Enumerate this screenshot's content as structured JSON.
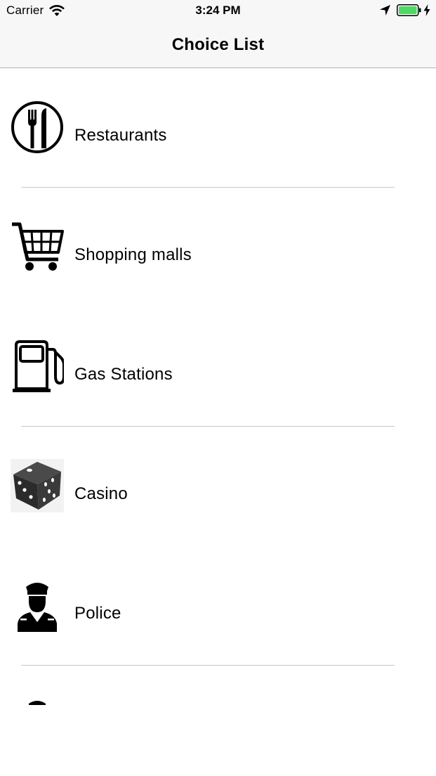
{
  "status_bar": {
    "carrier": "Carrier",
    "time": "3:24 PM",
    "battery_color": "#4cd964"
  },
  "nav": {
    "title": "Choice List"
  },
  "choices": [
    {
      "label": "Restaurants",
      "icon": "restaurant-icon"
    },
    {
      "label": "Shopping malls",
      "icon": "shopping-cart-icon"
    },
    {
      "label": "Gas Stations",
      "icon": "gas-pump-icon"
    },
    {
      "label": "Casino",
      "icon": "dice-icon"
    },
    {
      "label": "Police",
      "icon": "police-officer-icon"
    },
    {
      "label": "",
      "icon": "partial-icon"
    }
  ]
}
